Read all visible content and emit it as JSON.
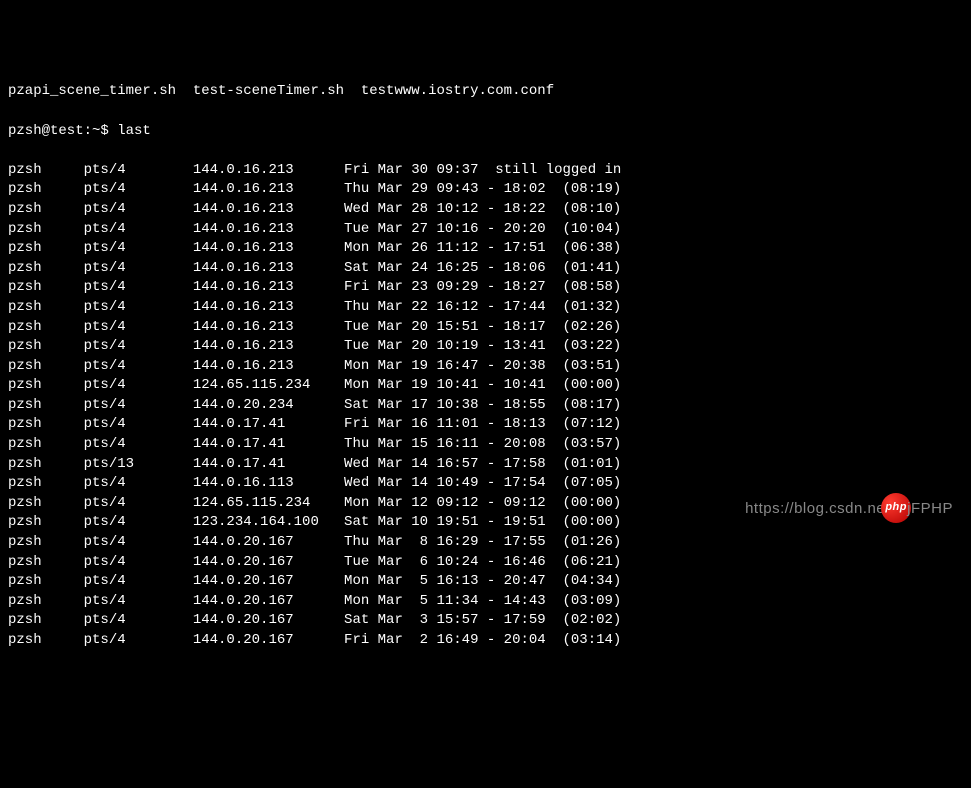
{
  "header": {
    "files_line": "pzapi_scene_timer.sh  test-sceneTimer.sh  testwww.iostry.com.conf",
    "prompt": "pzsh@test:~$ ",
    "command": "last"
  },
  "rows": [
    {
      "user": "pzsh",
      "tty": "pts/4",
      "ip": "144.0.16.213",
      "day": "Fri",
      "mon": "Mar",
      "date": "30",
      "start": "09:37",
      "sep": " ",
      "end": "  still",
      "dur": "logged in"
    },
    {
      "user": "pzsh",
      "tty": "pts/4",
      "ip": "144.0.16.213",
      "day": "Thu",
      "mon": "Mar",
      "date": "29",
      "start": "09:43",
      "sep": "-",
      "end": "18:02",
      "dur": "(08:19)"
    },
    {
      "user": "pzsh",
      "tty": "pts/4",
      "ip": "144.0.16.213",
      "day": "Wed",
      "mon": "Mar",
      "date": "28",
      "start": "10:12",
      "sep": "-",
      "end": "18:22",
      "dur": "(08:10)"
    },
    {
      "user": "pzsh",
      "tty": "pts/4",
      "ip": "144.0.16.213",
      "day": "Tue",
      "mon": "Mar",
      "date": "27",
      "start": "10:16",
      "sep": "-",
      "end": "20:20",
      "dur": "(10:04)"
    },
    {
      "user": "pzsh",
      "tty": "pts/4",
      "ip": "144.0.16.213",
      "day": "Mon",
      "mon": "Mar",
      "date": "26",
      "start": "11:12",
      "sep": "-",
      "end": "17:51",
      "dur": "(06:38)"
    },
    {
      "user": "pzsh",
      "tty": "pts/4",
      "ip": "144.0.16.213",
      "day": "Sat",
      "mon": "Mar",
      "date": "24",
      "start": "16:25",
      "sep": "-",
      "end": "18:06",
      "dur": "(01:41)"
    },
    {
      "user": "pzsh",
      "tty": "pts/4",
      "ip": "144.0.16.213",
      "day": "Fri",
      "mon": "Mar",
      "date": "23",
      "start": "09:29",
      "sep": "-",
      "end": "18:27",
      "dur": "(08:58)"
    },
    {
      "user": "pzsh",
      "tty": "pts/4",
      "ip": "144.0.16.213",
      "day": "Thu",
      "mon": "Mar",
      "date": "22",
      "start": "16:12",
      "sep": "-",
      "end": "17:44",
      "dur": "(01:32)"
    },
    {
      "user": "pzsh",
      "tty": "pts/4",
      "ip": "144.0.16.213",
      "day": "Tue",
      "mon": "Mar",
      "date": "20",
      "start": "15:51",
      "sep": "-",
      "end": "18:17",
      "dur": "(02:26)"
    },
    {
      "user": "pzsh",
      "tty": "pts/4",
      "ip": "144.0.16.213",
      "day": "Tue",
      "mon": "Mar",
      "date": "20",
      "start": "10:19",
      "sep": "-",
      "end": "13:41",
      "dur": "(03:22)"
    },
    {
      "user": "pzsh",
      "tty": "pts/4",
      "ip": "144.0.16.213",
      "day": "Mon",
      "mon": "Mar",
      "date": "19",
      "start": "16:47",
      "sep": "-",
      "end": "20:38",
      "dur": "(03:51)"
    },
    {
      "user": "pzsh",
      "tty": "pts/4",
      "ip": "124.65.115.234",
      "day": "Mon",
      "mon": "Mar",
      "date": "19",
      "start": "10:41",
      "sep": "-",
      "end": "10:41",
      "dur": "(00:00)"
    },
    {
      "user": "pzsh",
      "tty": "pts/4",
      "ip": "144.0.20.234",
      "day": "Sat",
      "mon": "Mar",
      "date": "17",
      "start": "10:38",
      "sep": "-",
      "end": "18:55",
      "dur": "(08:17)"
    },
    {
      "user": "pzsh",
      "tty": "pts/4",
      "ip": "144.0.17.41",
      "day": "Fri",
      "mon": "Mar",
      "date": "16",
      "start": "11:01",
      "sep": "-",
      "end": "18:13",
      "dur": "(07:12)"
    },
    {
      "user": "pzsh",
      "tty": "pts/4",
      "ip": "144.0.17.41",
      "day": "Thu",
      "mon": "Mar",
      "date": "15",
      "start": "16:11",
      "sep": "-",
      "end": "20:08",
      "dur": "(03:57)"
    },
    {
      "user": "pzsh",
      "tty": "pts/13",
      "ip": "144.0.17.41",
      "day": "Wed",
      "mon": "Mar",
      "date": "14",
      "start": "16:57",
      "sep": "-",
      "end": "17:58",
      "dur": "(01:01)"
    },
    {
      "user": "pzsh",
      "tty": "pts/4",
      "ip": "144.0.16.113",
      "day": "Wed",
      "mon": "Mar",
      "date": "14",
      "start": "10:49",
      "sep": "-",
      "end": "17:54",
      "dur": "(07:05)"
    },
    {
      "user": "pzsh",
      "tty": "pts/4",
      "ip": "124.65.115.234",
      "day": "Mon",
      "mon": "Mar",
      "date": "12",
      "start": "09:12",
      "sep": "-",
      "end": "09:12",
      "dur": "(00:00)"
    },
    {
      "user": "pzsh",
      "tty": "pts/4",
      "ip": "123.234.164.100",
      "day": "Sat",
      "mon": "Mar",
      "date": "10",
      "start": "19:51",
      "sep": "-",
      "end": "19:51",
      "dur": "(00:00)"
    },
    {
      "user": "pzsh",
      "tty": "pts/4",
      "ip": "144.0.20.167",
      "day": "Thu",
      "mon": "Mar",
      "date": " 8",
      "start": "16:29",
      "sep": "-",
      "end": "17:55",
      "dur": "(01:26)"
    },
    {
      "user": "pzsh",
      "tty": "pts/4",
      "ip": "144.0.20.167",
      "day": "Tue",
      "mon": "Mar",
      "date": " 6",
      "start": "10:24",
      "sep": "-",
      "end": "16:46",
      "dur": "(06:21)"
    },
    {
      "user": "pzsh",
      "tty": "pts/4",
      "ip": "144.0.20.167",
      "day": "Mon",
      "mon": "Mar",
      "date": " 5",
      "start": "16:13",
      "sep": "-",
      "end": "20:47",
      "dur": "(04:34)"
    },
    {
      "user": "pzsh",
      "tty": "pts/4",
      "ip": "144.0.20.167",
      "day": "Mon",
      "mon": "Mar",
      "date": " 5",
      "start": "11:34",
      "sep": "-",
      "end": "14:43",
      "dur": "(03:09)"
    },
    {
      "user": "pzsh",
      "tty": "pts/4",
      "ip": "144.0.20.167",
      "day": "Sat",
      "mon": "Mar",
      "date": " 3",
      "start": "15:57",
      "sep": "-",
      "end": "17:59",
      "dur": "(02:02)"
    },
    {
      "user": "pzsh",
      "tty": "pts/4",
      "ip": "144.0.20.167",
      "day": "Fri",
      "mon": "Mar",
      "date": " 2",
      "start": "16:49",
      "sep": "-",
      "end": "20:04",
      "dur": "(03:14)"
    }
  ],
  "watermark": {
    "pre": "https://blog.csdn.ne",
    "badge": "php",
    "post": "jFPHP"
  }
}
